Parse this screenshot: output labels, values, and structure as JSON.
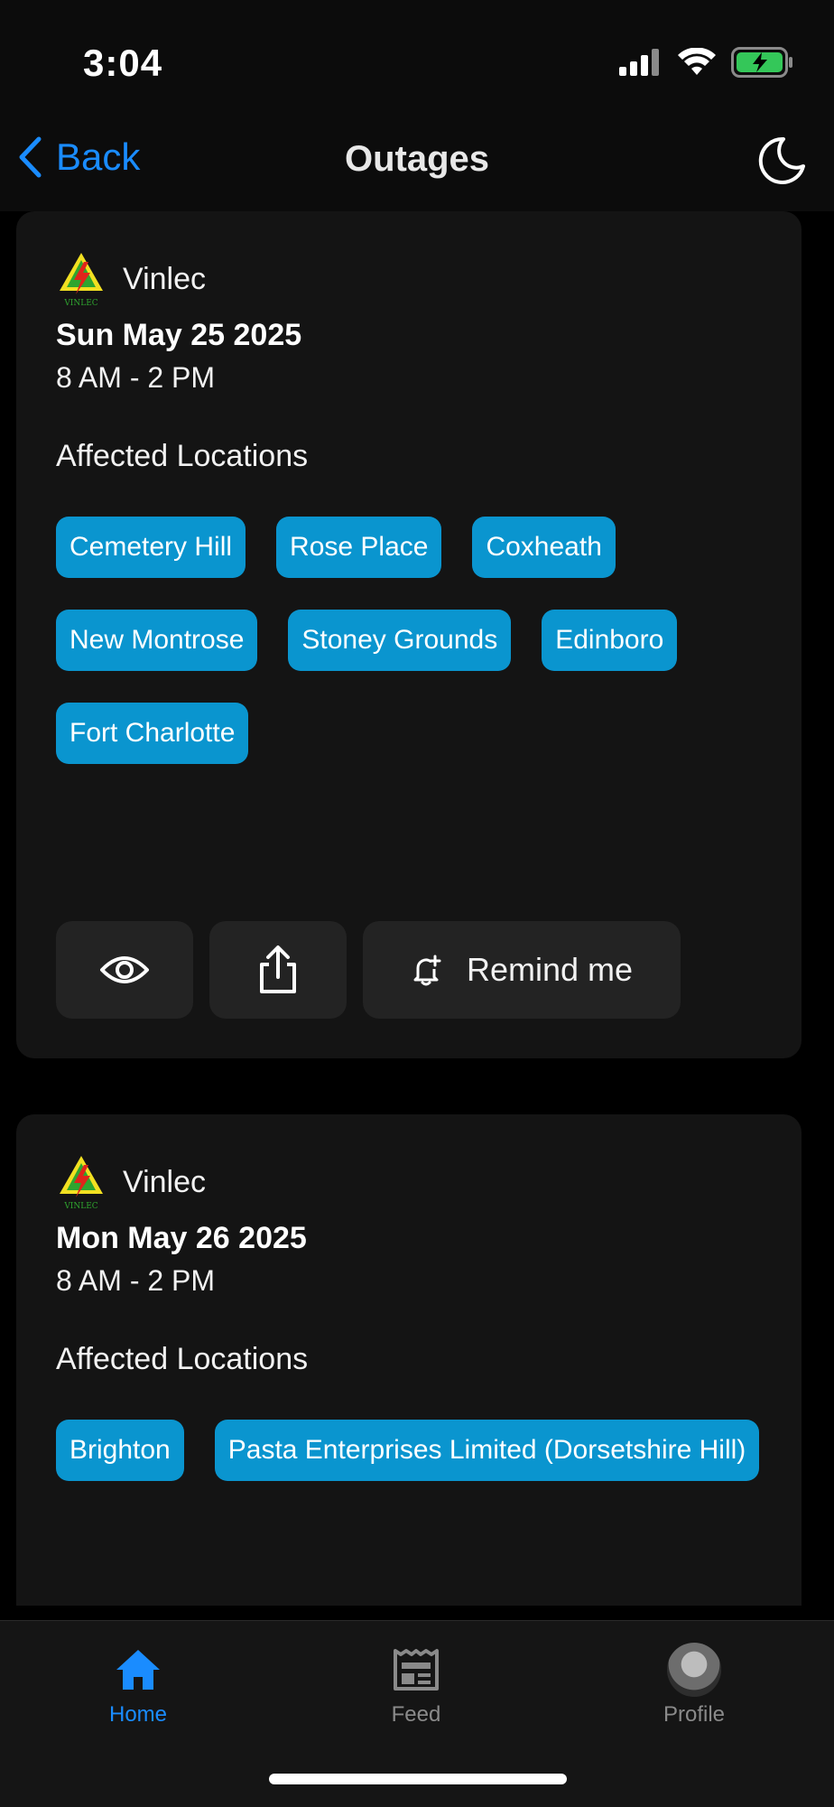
{
  "status_bar": {
    "time": "3:04"
  },
  "nav": {
    "back_label": "Back",
    "title": "Outages"
  },
  "outages": [
    {
      "provider": "Vinlec",
      "logo_text": "VINLEC",
      "date": "Sun May 25 2025",
      "hours": "8 AM - 2 PM",
      "affected_title": "Affected Locations",
      "locations": [
        "Cemetery Hill",
        "Rose Place",
        "Coxheath",
        "New Montrose",
        "Stoney Grounds",
        "Edinboro",
        "Fort Charlotte"
      ],
      "actions": {
        "remind_label": "Remind me"
      }
    },
    {
      "provider": "Vinlec",
      "logo_text": "VINLEC",
      "date": "Mon May 26 2025",
      "hours": "8 AM - 2 PM",
      "affected_title": "Affected Locations",
      "locations": [
        "Brighton",
        "Pasta Enterprises Limited (Dorsetshire Hill)"
      ]
    }
  ],
  "tabbar": {
    "home": "Home",
    "feed": "Feed",
    "profile": "Profile"
  },
  "colors": {
    "accent": "#1a8cff",
    "chip": "#0a95cf",
    "card": "#141414"
  }
}
